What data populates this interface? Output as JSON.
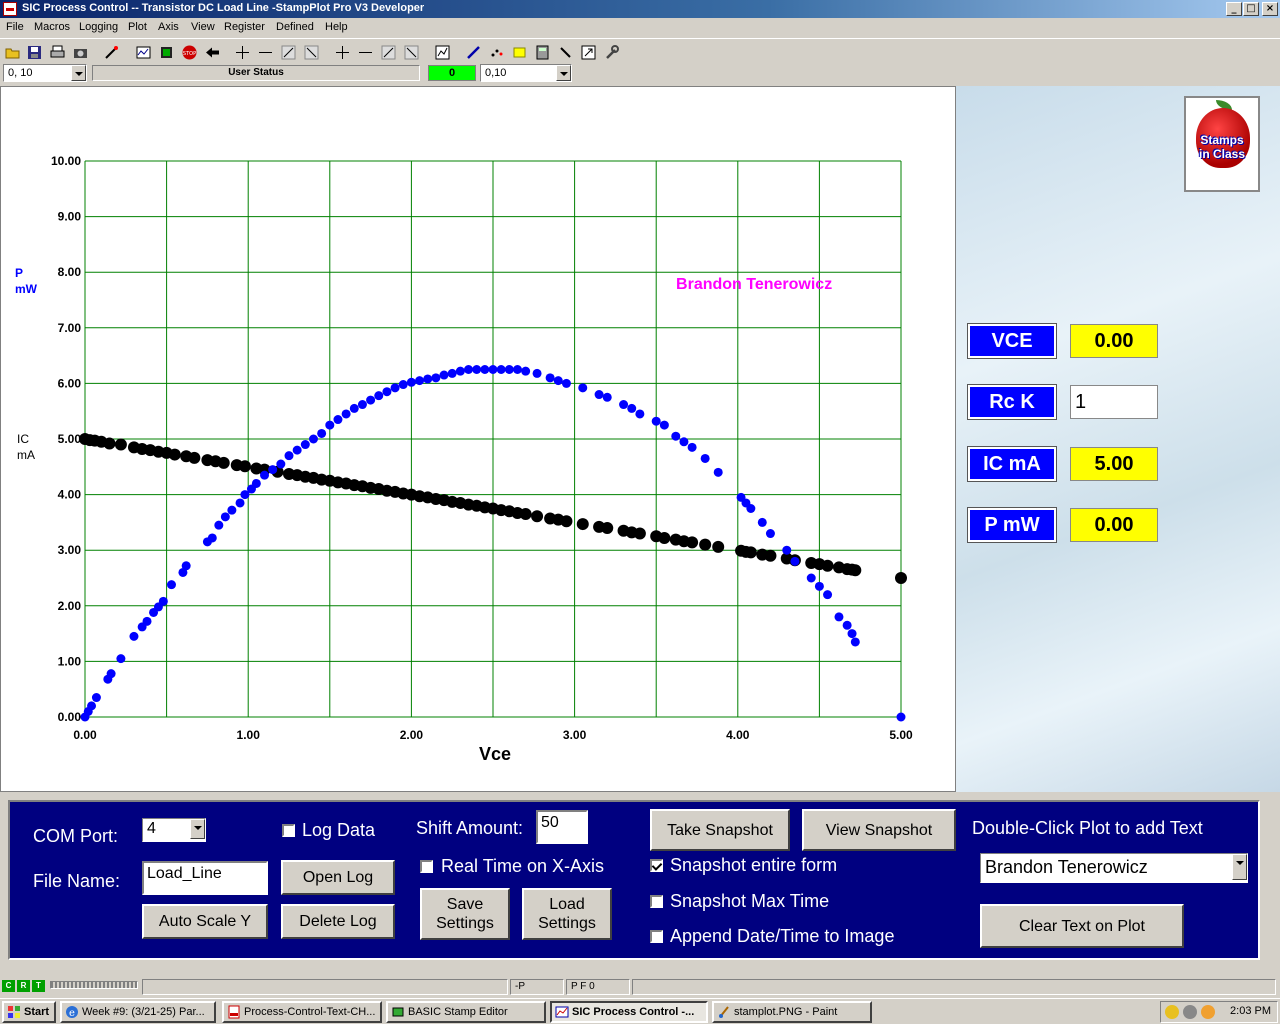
{
  "window": {
    "title": "SIC Process Control -- Transistor DC Load Line -StampPlot Pro V3 Developer",
    "buttons": [
      "_",
      "□",
      "×"
    ]
  },
  "menu": [
    "File",
    "Macros",
    "Logging",
    "Plot",
    "Axis",
    "View",
    "Register",
    "Defined",
    "Help"
  ],
  "toolbar_icons": [
    "open-folder-icon",
    "save-icon",
    "print-icon",
    "camera-icon",
    "wand-icon",
    "scope-icon",
    "chip-icon",
    "stop-icon",
    "back-arrow-icon",
    "x-zoom-in-icon",
    "x-zoom-out-icon",
    "x-shift-left-icon",
    "x-shift-right-icon",
    "y-zoom-in-icon",
    "y-zoom-out-icon",
    "y-shift-up-icon",
    "y-shift-down-icon",
    "chart-icon",
    "pen-icon",
    "points-icon",
    "highlight-icon",
    "calculator-icon",
    "pencil-icon",
    "expand-icon",
    "wrench-icon"
  ],
  "status_row": {
    "left_combo": "0, 10",
    "user_status": "User Status",
    "indicator_value": "0",
    "right_combo": "0,10",
    "indicator_color": "#00ff00"
  },
  "chart_data": {
    "type": "scatter",
    "xlabel": "Vce",
    "ylabel_series": [
      {
        "name": "P",
        "unit": "mW",
        "color": "#0000ff"
      },
      {
        "name": "IC",
        "unit": "mA",
        "color": "#000000"
      }
    ],
    "x_ticks": [
      "0.00",
      "1.00",
      "2.00",
      "3.00",
      "4.00",
      "5.00"
    ],
    "y_ticks": [
      "0.00",
      "1.00",
      "2.00",
      "3.00",
      "4.00",
      "5.00",
      "6.00",
      "7.00",
      "8.00",
      "9.00",
      "10.00"
    ],
    "xlim": [
      0,
      5
    ],
    "ylim": [
      0,
      10
    ],
    "grid": true,
    "grid_color": "#008000",
    "annotation": {
      "text": "Brandon Tenerowicz",
      "x": 4.1,
      "y": 7.7,
      "color": "#ff00ff"
    },
    "series": [
      {
        "name": "IC",
        "color": "#000000",
        "x": [
          0.0,
          0.03,
          0.06,
          0.1,
          0.15,
          0.22,
          0.3,
          0.35,
          0.4,
          0.45,
          0.5,
          0.55,
          0.62,
          0.67,
          0.75,
          0.8,
          0.85,
          0.93,
          0.98,
          1.05,
          1.1,
          1.18,
          1.25,
          1.3,
          1.35,
          1.4,
          1.45,
          1.5,
          1.55,
          1.6,
          1.65,
          1.7,
          1.75,
          1.8,
          1.85,
          1.9,
          1.95,
          2.0,
          2.05,
          2.1,
          2.15,
          2.2,
          2.25,
          2.3,
          2.35,
          2.4,
          2.45,
          2.5,
          2.55,
          2.6,
          2.65,
          2.7,
          2.77,
          2.85,
          2.9,
          2.95,
          3.05,
          3.15,
          3.2,
          3.3,
          3.35,
          3.4,
          3.5,
          3.55,
          3.62,
          3.67,
          3.72,
          3.8,
          3.88,
          4.02,
          4.05,
          4.08,
          4.15,
          4.2,
          4.3,
          4.35,
          4.45,
          4.5,
          4.55,
          4.62,
          4.67,
          4.7,
          4.72,
          5.0
        ],
        "y": [
          5.0,
          4.98,
          4.97,
          4.95,
          4.92,
          4.9,
          4.85,
          4.82,
          4.8,
          4.77,
          4.75,
          4.72,
          4.69,
          4.66,
          4.62,
          4.6,
          4.57,
          4.53,
          4.51,
          4.47,
          4.45,
          4.41,
          4.37,
          4.35,
          4.32,
          4.3,
          4.27,
          4.25,
          4.22,
          4.2,
          4.17,
          4.15,
          4.12,
          4.1,
          4.07,
          4.05,
          4.02,
          4.0,
          3.97,
          3.95,
          3.92,
          3.9,
          3.87,
          3.85,
          3.82,
          3.8,
          3.77,
          3.75,
          3.72,
          3.7,
          3.67,
          3.65,
          3.61,
          3.57,
          3.55,
          3.52,
          3.47,
          3.42,
          3.4,
          3.35,
          3.32,
          3.3,
          3.25,
          3.22,
          3.19,
          3.16,
          3.14,
          3.1,
          3.06,
          2.99,
          2.97,
          2.96,
          2.92,
          2.9,
          2.85,
          2.82,
          2.77,
          2.75,
          2.72,
          2.69,
          2.66,
          2.65,
          2.64,
          2.5
        ]
      },
      {
        "name": "P",
        "color": "#0000ff",
        "x": [
          0.0,
          0.02,
          0.04,
          0.07,
          0.14,
          0.16,
          0.22,
          0.3,
          0.35,
          0.38,
          0.42,
          0.45,
          0.48,
          0.53,
          0.6,
          0.62,
          0.75,
          0.78,
          0.82,
          0.86,
          0.9,
          0.95,
          0.98,
          1.02,
          1.05,
          1.1,
          1.15,
          1.2,
          1.25,
          1.3,
          1.35,
          1.4,
          1.45,
          1.5,
          1.55,
          1.6,
          1.65,
          1.7,
          1.75,
          1.8,
          1.85,
          1.9,
          1.95,
          2.0,
          2.05,
          2.1,
          2.15,
          2.2,
          2.25,
          2.3,
          2.35,
          2.4,
          2.45,
          2.5,
          2.55,
          2.6,
          2.65,
          2.7,
          2.77,
          2.85,
          2.9,
          2.95,
          3.05,
          3.15,
          3.2,
          3.3,
          3.35,
          3.4,
          3.5,
          3.55,
          3.62,
          3.67,
          3.72,
          3.8,
          3.88,
          4.02,
          4.05,
          4.08,
          4.15,
          4.2,
          4.3,
          4.35,
          4.45,
          4.5,
          4.55,
          4.62,
          4.67,
          4.7,
          4.72,
          5.0
        ],
        "y": [
          0.0,
          0.1,
          0.2,
          0.35,
          0.68,
          0.78,
          1.05,
          1.45,
          1.62,
          1.72,
          1.88,
          1.98,
          2.08,
          2.38,
          2.6,
          2.72,
          3.15,
          3.22,
          3.45,
          3.6,
          3.72,
          3.85,
          4.0,
          4.1,
          4.2,
          4.35,
          4.45,
          4.55,
          4.7,
          4.8,
          4.9,
          5.0,
          5.1,
          5.25,
          5.35,
          5.45,
          5.55,
          5.62,
          5.7,
          5.78,
          5.85,
          5.92,
          5.98,
          6.02,
          6.05,
          6.08,
          6.1,
          6.15,
          6.18,
          6.22,
          6.25,
          6.25,
          6.25,
          6.25,
          6.25,
          6.25,
          6.25,
          6.22,
          6.18,
          6.1,
          6.05,
          6.0,
          5.92,
          5.8,
          5.75,
          5.62,
          5.55,
          5.45,
          5.32,
          5.25,
          5.05,
          4.95,
          4.85,
          4.65,
          4.4,
          3.95,
          3.85,
          3.75,
          3.5,
          3.3,
          3.0,
          2.8,
          2.5,
          2.35,
          2.2,
          1.8,
          1.65,
          1.5,
          1.35,
          0.0
        ]
      }
    ]
  },
  "readouts": [
    {
      "label": "VCE",
      "value": "0.00",
      "bg": "#ffff00"
    },
    {
      "label": "Rc K",
      "value": "1",
      "bg": "#ffffff"
    },
    {
      "label": "IC mA",
      "value": "5.00",
      "bg": "#ffff00"
    },
    {
      "label": "P mW",
      "value": "0.00",
      "bg": "#ffff00"
    }
  ],
  "logo_text": [
    "Stamps",
    "in Class"
  ],
  "controls": {
    "com_port_label": "COM Port:",
    "com_port_value": "4",
    "file_name_label": "File Name:",
    "file_name_value": "Load_Line",
    "log_data_label": "Log Data",
    "open_log": "Open Log",
    "auto_scale_y": "Auto Scale Y",
    "delete_log": "Delete Log",
    "shift_amount_label": "Shift Amount:",
    "shift_amount_value": "50",
    "real_time_label": "Real Time on X-Axis",
    "save_settings": "Save Settings",
    "load_settings": "Load Settings",
    "take_snapshot": "Take Snapshot",
    "view_snapshot": "View Snapshot",
    "snapshot_entire_form": "Snapshot entire form",
    "snapshot_max_time": "Snapshot Max Time",
    "append_datetime": "Append Date/Time to Image",
    "double_click_hint": "Double-Click Plot to add Text",
    "plot_text_value": "Brandon Tenerowicz",
    "clear_text": "Clear Text on Plot"
  },
  "bottom_status": {
    "indicators": [
      "C",
      "R",
      "T"
    ],
    "field1": "-P",
    "field2": "P F 0"
  },
  "taskbar": {
    "start": "Start",
    "tasks": [
      {
        "label": "Week #9: (3/21-25) Par...",
        "icon": "ie-icon"
      },
      {
        "label": "Process-Control-Text-CH...",
        "icon": "pdf-icon"
      },
      {
        "label": "BASIC Stamp Editor",
        "icon": "stamp-editor-icon"
      },
      {
        "label": "SIC Process Control -...",
        "icon": "sic-icon",
        "active": true
      },
      {
        "label": "stamplot.PNG - Paint",
        "icon": "paint-icon"
      }
    ],
    "clock": "2:03 PM"
  }
}
